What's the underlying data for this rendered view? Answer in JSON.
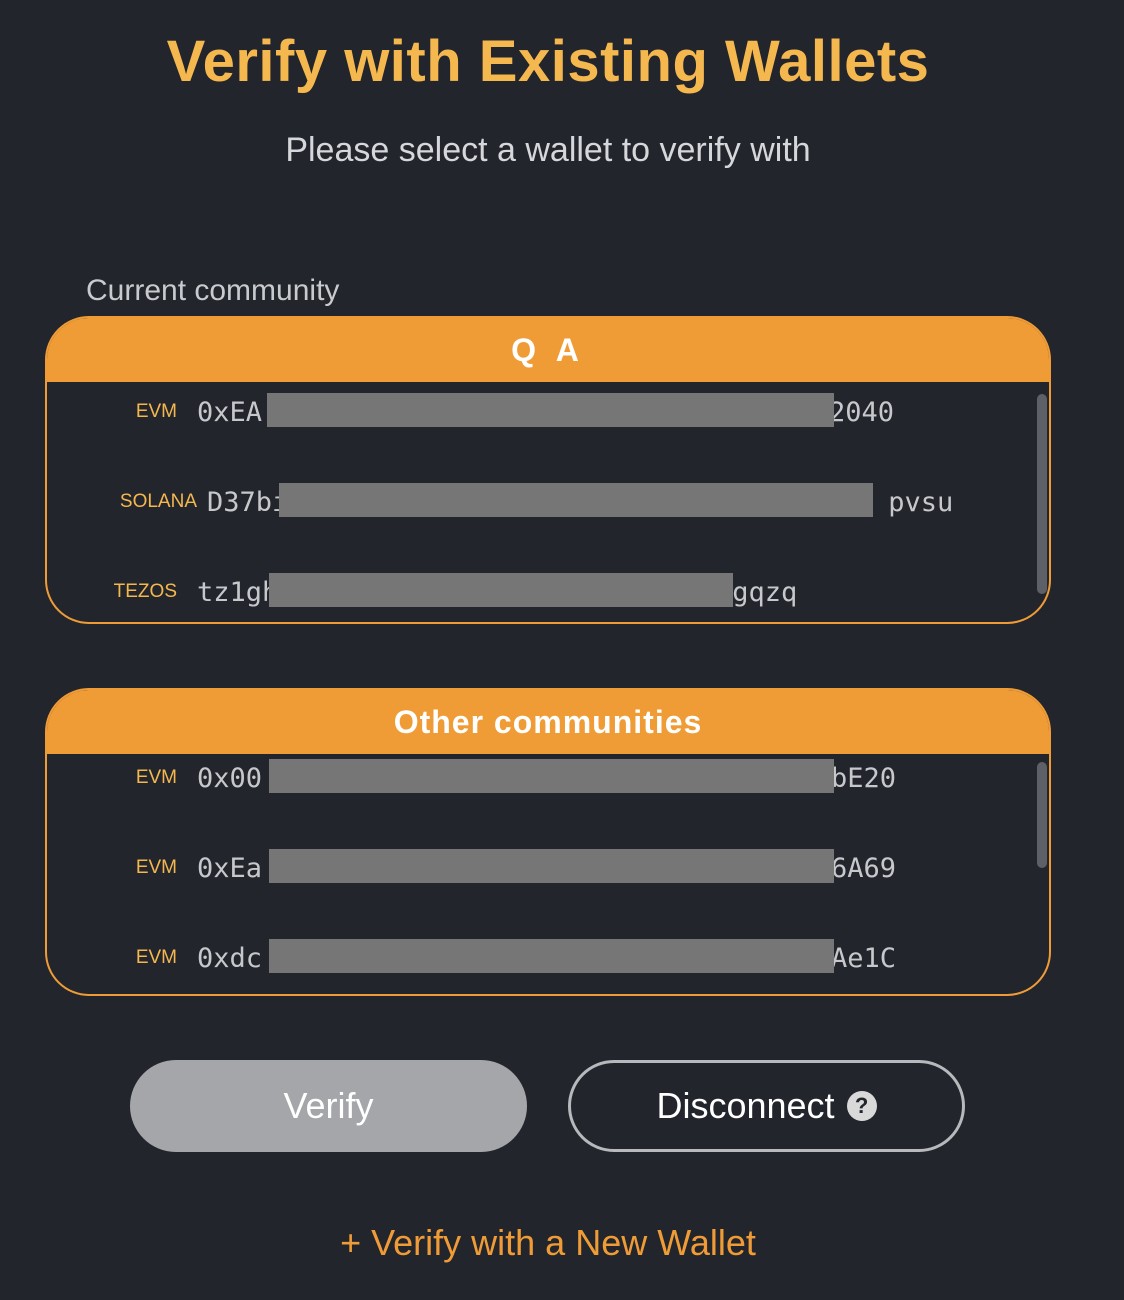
{
  "title": "Verify with Existing Wallets",
  "subtitle": "Please select a wallet to verify with",
  "current_section_label": "Current community",
  "current_community": {
    "name": "Q A",
    "wallets": [
      {
        "chain": "EVM",
        "address_start": "0xEA",
        "address_end": "2040"
      },
      {
        "chain": "SOLANA",
        "address_start": "D37bi",
        "address_end": "pvsu"
      },
      {
        "chain": "TEZOS",
        "address_start": "tz1gh",
        "address_end": "gqzq"
      }
    ]
  },
  "other_communities": {
    "name": "Other communities",
    "wallets": [
      {
        "chain": "EVM",
        "address_start": "0x00",
        "address_end": "bE20"
      },
      {
        "chain": "EVM",
        "address_start": "0xEa",
        "address_end": "6A69"
      },
      {
        "chain": "EVM",
        "address_start": "0xdc",
        "address_end": "Ae1C"
      }
    ]
  },
  "buttons": {
    "verify": "Verify",
    "disconnect": "Disconnect",
    "help": "?"
  },
  "new_wallet_link": "+ Verify with a New Wallet",
  "colors": {
    "background": "#23252d",
    "accent": "#f09c36",
    "title": "#f5b84e"
  }
}
